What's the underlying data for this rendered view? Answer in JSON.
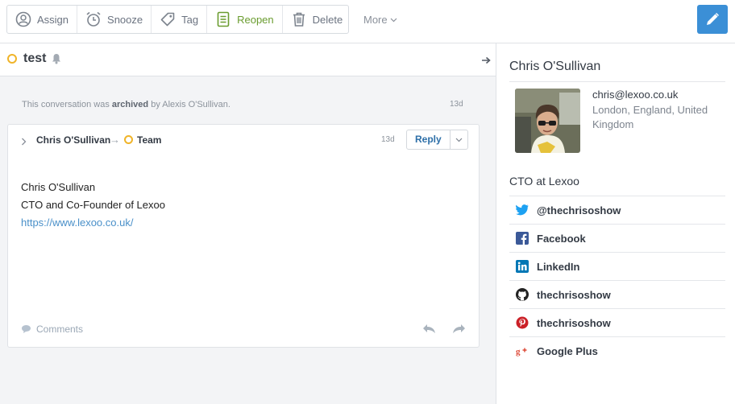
{
  "toolbar": {
    "assign_label": "Assign",
    "snooze_label": "Snooze",
    "tag_label": "Tag",
    "reopen_label": "Reopen",
    "delete_label": "Delete",
    "more_label": "More"
  },
  "conversation": {
    "title": "test",
    "archived_prefix": "This conversation was ",
    "archived_word": "archived",
    "archived_suffix": " by Alexis O'Sullivan.",
    "archived_time": "13d",
    "message": {
      "from": "Chris O'Sullivan",
      "to": "Team",
      "time": "13d",
      "reply_label": "Reply",
      "body_line1": "Chris O'Sullivan",
      "body_line2": "CTO and Co-Founder of Lexoo",
      "body_link": "https://www.lexoo.co.uk/",
      "comments_label": "Comments"
    }
  },
  "profile": {
    "name": "Chris O'Sullivan",
    "email": "chris@lexoo.co.uk",
    "location": "London, England, United Kingdom",
    "role": "CTO at Lexoo",
    "social": [
      {
        "label": "@thechrisoshow",
        "icon": "twitter-icon",
        "color": "#1da1f2"
      },
      {
        "label": "Facebook",
        "icon": "facebook-icon",
        "color": "#3b5998"
      },
      {
        "label": "LinkedIn",
        "icon": "linkedin-icon",
        "color": "#0077b5"
      },
      {
        "label": "thechrisoshow",
        "icon": "github-icon",
        "color": "#222222"
      },
      {
        "label": "thechrisoshow",
        "icon": "pinterest-icon",
        "color": "#cb2027"
      },
      {
        "label": "Google Plus",
        "icon": "google-plus-icon",
        "color": "#dd4b39"
      }
    ]
  },
  "colors": {
    "accent": "#3b8fd6",
    "status_open": "#f0b429",
    "reopen_green": "#6a9c2f"
  }
}
